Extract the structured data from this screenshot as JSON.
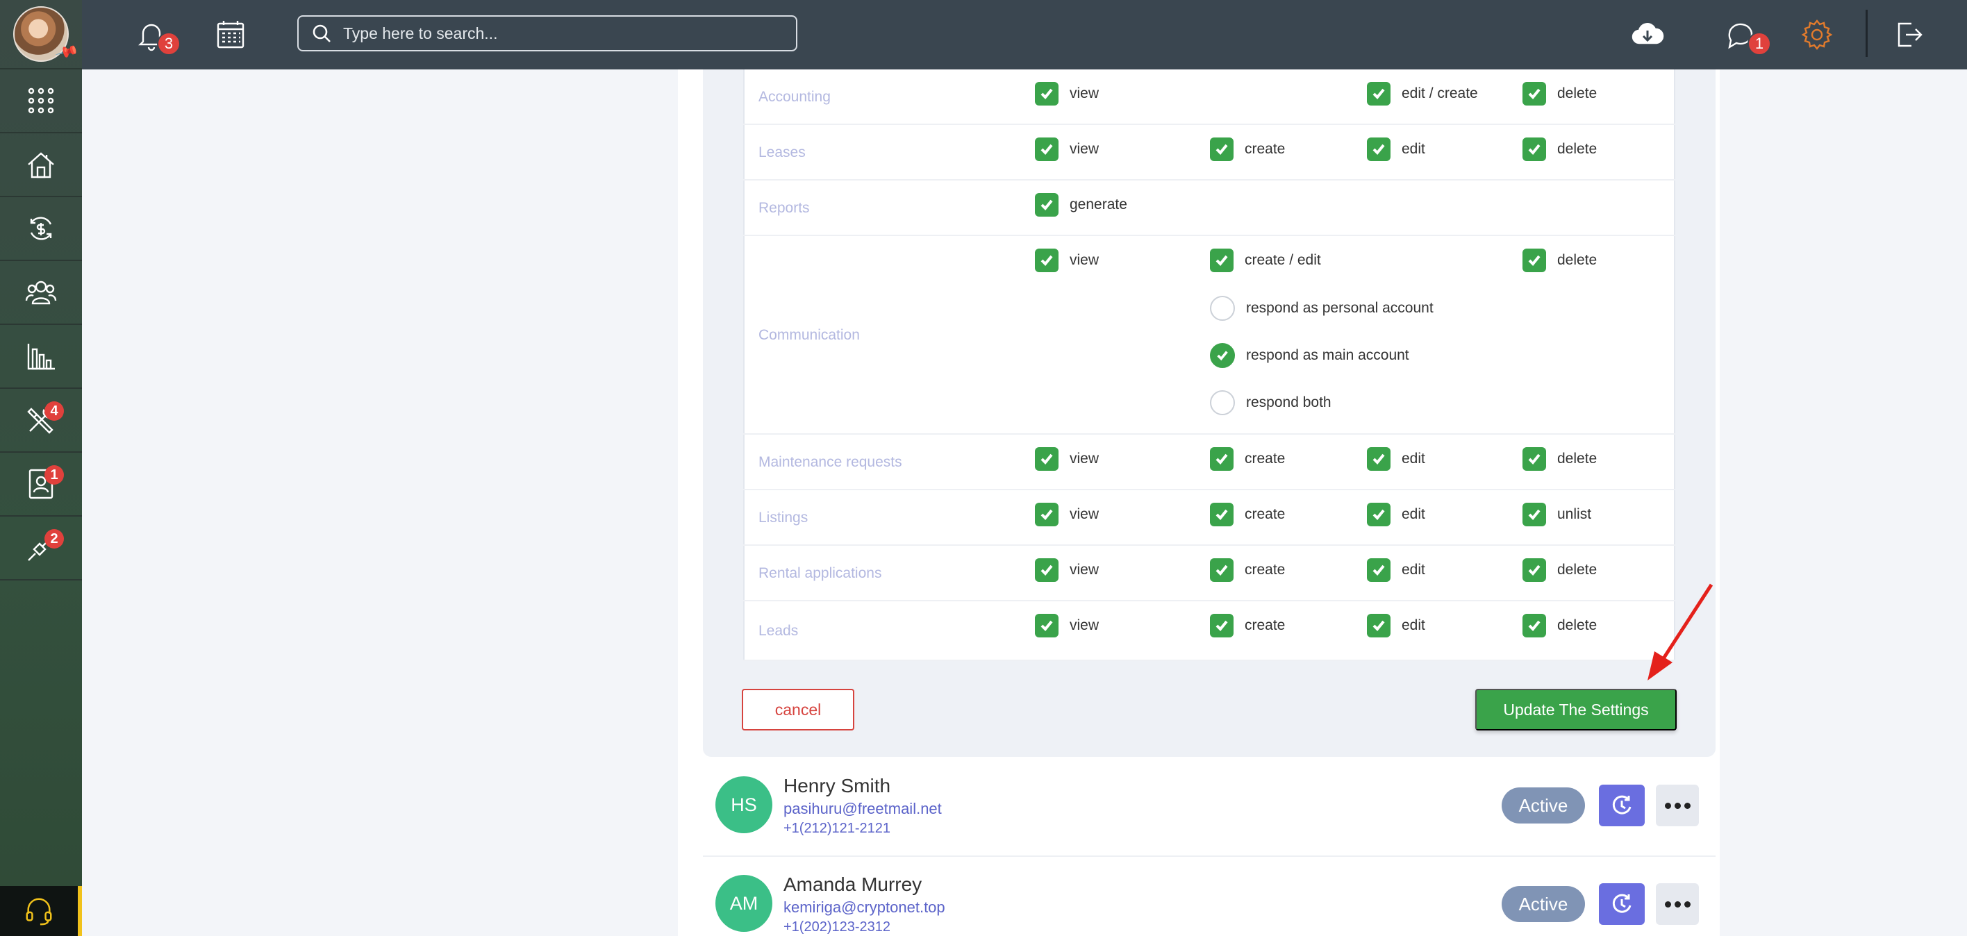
{
  "topbar": {
    "search_placeholder": "Type here to search...",
    "notification_count": "3",
    "message_count": "1"
  },
  "sidebar": {
    "badges": {
      "tools": "4",
      "tenants": "1",
      "integrations": "2"
    }
  },
  "permissions": [
    {
      "label": "Accounting",
      "items": [
        {
          "col": 0,
          "text": "view",
          "checked": true
        },
        {
          "col": 2,
          "text": "edit / create",
          "checked": true
        },
        {
          "col": 3,
          "text": "delete",
          "checked": true
        }
      ]
    },
    {
      "label": "Leases",
      "items": [
        {
          "col": 0,
          "text": "view",
          "checked": true
        },
        {
          "col": 1,
          "text": "create",
          "checked": true
        },
        {
          "col": 2,
          "text": "edit",
          "checked": true
        },
        {
          "col": 3,
          "text": "delete",
          "checked": true
        }
      ]
    },
    {
      "label": "Reports",
      "items": [
        {
          "col": 0,
          "text": "generate",
          "checked": true
        }
      ]
    },
    {
      "label": "Communication",
      "items": [
        {
          "col": 0,
          "text": "view",
          "checked": true
        },
        {
          "col": 1,
          "text": "create / edit",
          "checked": true
        },
        {
          "col": 3,
          "text": "delete",
          "checked": true
        }
      ],
      "options": [
        {
          "text": "respond as personal account",
          "selected": false
        },
        {
          "text": "respond as main account",
          "selected": true
        },
        {
          "text": "respond both",
          "selected": false
        }
      ]
    },
    {
      "label": "Maintenance requests",
      "items": [
        {
          "col": 0,
          "text": "view",
          "checked": true
        },
        {
          "col": 1,
          "text": "create",
          "checked": true
        },
        {
          "col": 2,
          "text": "edit",
          "checked": true
        },
        {
          "col": 3,
          "text": "delete",
          "checked": true
        }
      ]
    },
    {
      "label": "Listings",
      "items": [
        {
          "col": 0,
          "text": "view",
          "checked": true
        },
        {
          "col": 1,
          "text": "create",
          "checked": true
        },
        {
          "col": 2,
          "text": "edit",
          "checked": true
        },
        {
          "col": 3,
          "text": "unlist",
          "checked": true
        }
      ]
    },
    {
      "label": "Rental applications",
      "items": [
        {
          "col": 0,
          "text": "view",
          "checked": true
        },
        {
          "col": 1,
          "text": "create",
          "checked": true
        },
        {
          "col": 2,
          "text": "edit",
          "checked": true
        },
        {
          "col": 3,
          "text": "delete",
          "checked": true
        }
      ]
    },
    {
      "label": "Leads",
      "items": [
        {
          "col": 0,
          "text": "view",
          "checked": true
        },
        {
          "col": 1,
          "text": "create",
          "checked": true
        },
        {
          "col": 2,
          "text": "edit",
          "checked": true
        },
        {
          "col": 3,
          "text": "delete",
          "checked": true
        }
      ]
    }
  ],
  "actions": {
    "cancel_label": "cancel",
    "update_label": "Update The Settings"
  },
  "users": [
    {
      "initials": "HS",
      "name": "Henry Smith",
      "email": "pasihuru@freetmail.net",
      "phone": "+1(212)121-2121",
      "status": "Active"
    },
    {
      "initials": "AM",
      "name": "Amanda Murrey",
      "email": "kemiriga@cryptonet.top",
      "phone": "+1(202)123-2312",
      "status": "Active"
    }
  ]
}
